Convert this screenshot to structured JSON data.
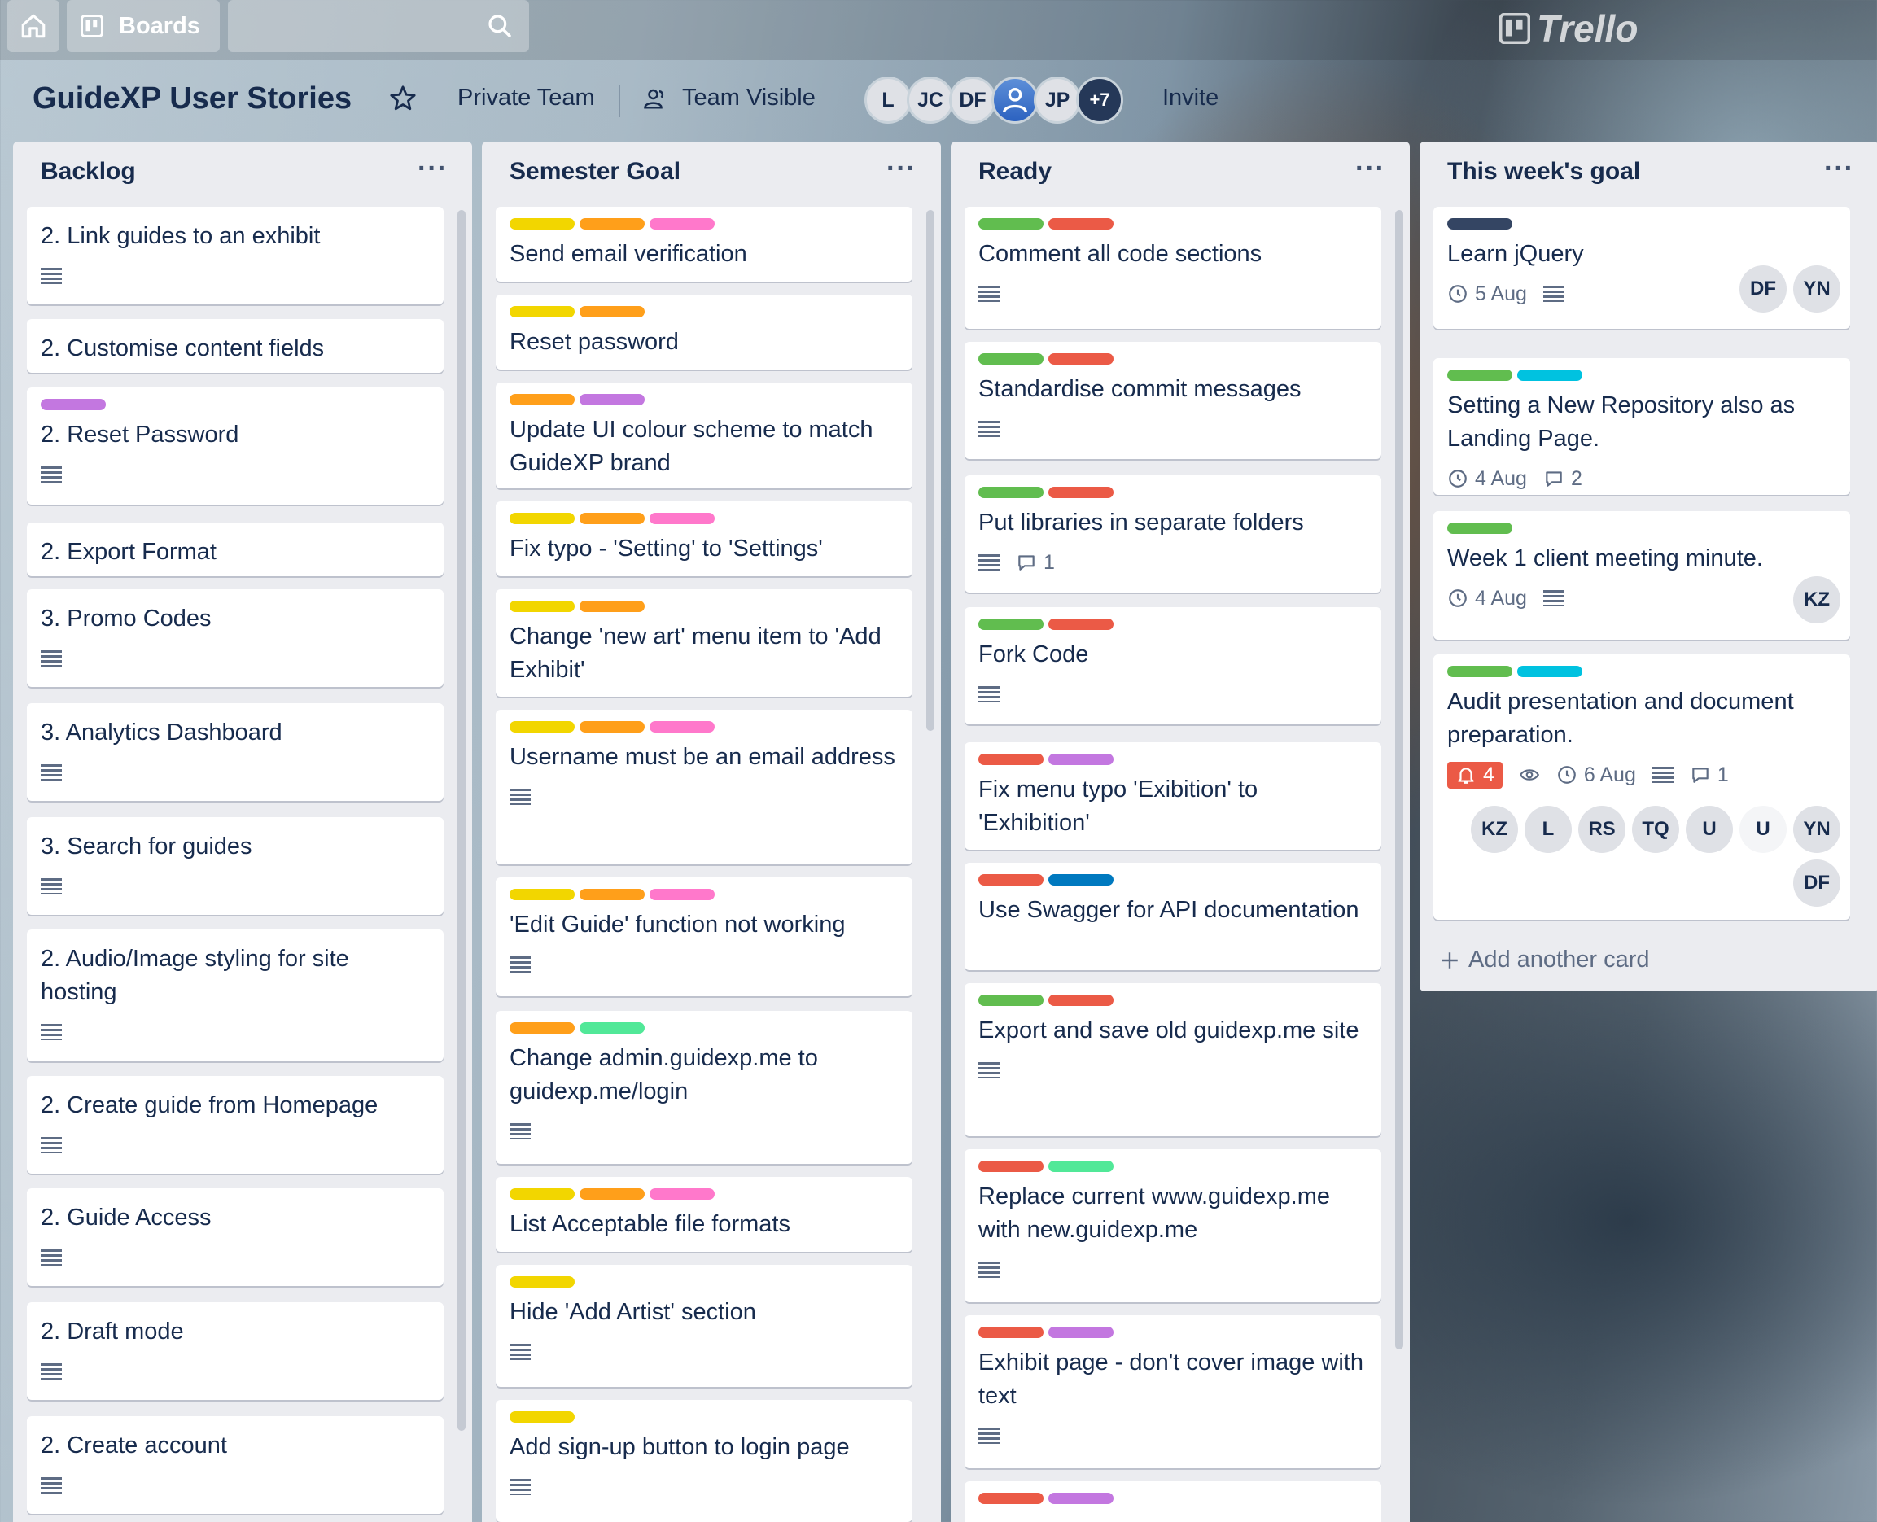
{
  "topbar": {
    "boards_label": "Boards",
    "logo": "Trello"
  },
  "header": {
    "title": "GuideXP User Stories",
    "private_team": "Private Team",
    "team_visible": "Team Visible",
    "invite": "Invite",
    "members": [
      {
        "initials": "L"
      },
      {
        "initials": "JC"
      },
      {
        "initials": "DF"
      },
      {
        "initials": "",
        "photo": true
      },
      {
        "initials": "JP"
      },
      {
        "initials": "+7",
        "more": true
      }
    ]
  },
  "colors": {
    "yellow": "#f2d600",
    "orange": "#ff9f1a",
    "pink": "#ff78cb",
    "purple": "#c377e0",
    "green": "#61bd4f",
    "red": "#eb5a46",
    "sky": "#00c2e0",
    "lime": "#51e898",
    "blue": "#0079bf",
    "navy": "#344563"
  },
  "lists": [
    {
      "title": "Backlog",
      "cards": [
        {
          "title": "2. Link guides to an exhibit",
          "labels": [],
          "desc": true
        },
        {
          "title": "2. Customise content fields",
          "labels": [],
          "desc": false
        },
        {
          "title": "2. Reset Password",
          "labels": [
            "purple"
          ],
          "desc": true
        },
        {
          "title": "2. Export Format",
          "labels": [],
          "desc": false
        },
        {
          "title": "3. Promo Codes",
          "labels": [],
          "desc": true
        },
        {
          "title": "3. Analytics Dashboard",
          "labels": [],
          "desc": true
        },
        {
          "title": "3. Search for guides",
          "labels": [],
          "desc": true
        },
        {
          "title": "2. Audio/Image styling for site hosting",
          "labels": [],
          "desc": true
        },
        {
          "title": "2. Create guide from Homepage",
          "labels": [],
          "desc": true
        },
        {
          "title": "2. Guide Access",
          "labels": [],
          "desc": true
        },
        {
          "title": "2. Draft mode",
          "labels": [],
          "desc": true
        },
        {
          "title": "2. Create account",
          "labels": [],
          "desc": true
        }
      ]
    },
    {
      "title": "Semester Goal",
      "cards": [
        {
          "title": "Send email verification",
          "labels": [
            "yellow",
            "orange",
            "pink"
          ],
          "desc": false
        },
        {
          "title": "Reset password",
          "labels": [
            "yellow",
            "orange"
          ],
          "desc": false
        },
        {
          "title": "Update UI colour scheme to match GuideXP brand",
          "labels": [
            "orange",
            "purple"
          ],
          "desc": false
        },
        {
          "title": "Fix typo - 'Setting' to 'Settings'",
          "labels": [
            "yellow",
            "orange",
            "pink"
          ],
          "desc": false
        },
        {
          "title": "Change 'new art' menu item to 'Add Exhibit'",
          "labels": [
            "yellow",
            "orange"
          ],
          "desc": false
        },
        {
          "title": "Username must be an email address",
          "labels": [
            "yellow",
            "orange",
            "pink"
          ],
          "desc": true
        },
        {
          "title": "'Edit Guide' function not working",
          "labels": [
            "yellow",
            "orange",
            "pink"
          ],
          "desc": true
        },
        {
          "title": "Change admin.guidexp.me to guidexp.me/login",
          "labels": [
            "orange",
            "lime"
          ],
          "desc": true
        },
        {
          "title": "List Acceptable file formats",
          "labels": [
            "yellow",
            "orange",
            "pink"
          ],
          "desc": false
        },
        {
          "title": "Hide 'Add Artist' section",
          "labels": [
            "yellow"
          ],
          "desc": true
        },
        {
          "title": "Add sign-up button to login page",
          "labels": [
            "yellow"
          ],
          "desc": true
        }
      ]
    },
    {
      "title": "Ready",
      "cards": [
        {
          "title": "Comment all code sections",
          "labels": [
            "green",
            "red"
          ],
          "desc": true
        },
        {
          "title": "Standardise commit messages",
          "labels": [
            "green",
            "red"
          ],
          "desc": true
        },
        {
          "title": "Put libraries in separate folders",
          "labels": [
            "green",
            "red"
          ],
          "desc": true,
          "comments": "1"
        },
        {
          "title": "Fork Code",
          "labels": [
            "green",
            "red"
          ],
          "desc": true
        },
        {
          "title": "Fix menu typo 'Exibition' to 'Exhibition'",
          "labels": [
            "red",
            "purple"
          ],
          "desc": false
        },
        {
          "title": "Use Swagger for API documentation",
          "labels": [
            "red",
            "blue"
          ],
          "desc": false
        },
        {
          "title": "Export and save old guidexp.me site",
          "labels": [
            "green",
            "red"
          ],
          "desc": true
        },
        {
          "title": "Replace current www.guidexp.me with new.guidexp.me",
          "labels": [
            "red",
            "lime"
          ],
          "desc": true
        },
        {
          "title": "Exhibit page - don't cover image with text",
          "labels": [
            "red",
            "purple"
          ],
          "desc": true
        },
        {
          "title": "",
          "labels": [
            "red",
            "purple"
          ],
          "desc": false
        }
      ]
    },
    {
      "title": "This week's goal",
      "add_card": "Add another card",
      "cards": [
        {
          "title": "Learn jQuery",
          "labels": [
            "navy"
          ],
          "due": "5 Aug",
          "desc": true,
          "members": [
            "DF",
            "YN"
          ]
        },
        {
          "title": "Setting a New Repository also as Landing Page.",
          "labels": [
            "green",
            "sky"
          ],
          "due": "4 Aug",
          "comments": "2"
        },
        {
          "title": "Week 1 client meeting minute.",
          "labels": [
            "green"
          ],
          "due": "4 Aug",
          "desc": true,
          "members": [
            "KZ"
          ]
        },
        {
          "title": "Audit presentation and document preparation.",
          "labels": [
            "green",
            "sky"
          ],
          "notifications": "4",
          "watch": true,
          "due": "6 Aug",
          "desc": true,
          "comments": "1",
          "members": [
            "KZ",
            "L",
            "RS",
            "TQ",
            "U",
            "U",
            "YN",
            "DF"
          ]
        }
      ]
    }
  ]
}
